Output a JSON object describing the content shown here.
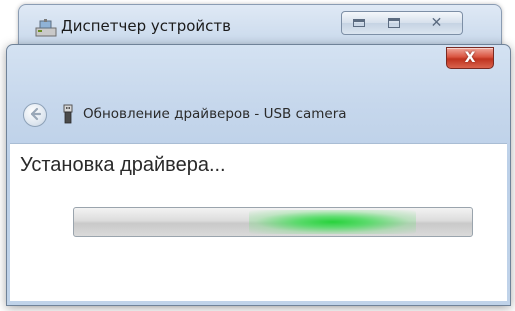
{
  "background_window": {
    "title": "Диспетчер устройств",
    "icon": "device-manager-icon",
    "buttons": [
      "minimize-icon",
      "maximize-icon",
      "close-icon"
    ]
  },
  "dialog": {
    "title": "Обновление драйверов - USB camera",
    "icons": [
      "back-arrow-icon",
      "usb-device-icon"
    ],
    "close_glyph": "X",
    "status": "Установка драйвера...",
    "progress": {
      "mode": "indeterminate",
      "marquee_position": 0.65,
      "color": "#2fd144"
    }
  },
  "colors": {
    "titlebar": "#c9d9ec",
    "close_button": "#d9533f",
    "content_bg": "#ffffff"
  }
}
